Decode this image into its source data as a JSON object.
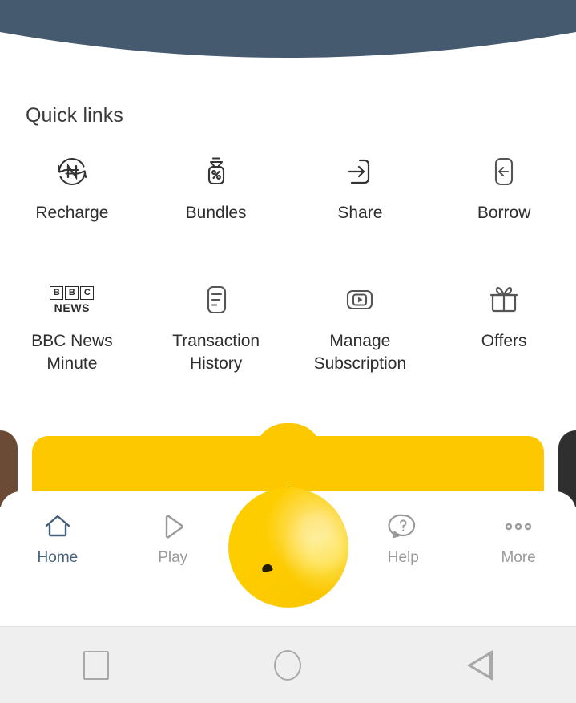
{
  "header": {
    "background_color": "#45596f",
    "shape": "curved-bottom-banner"
  },
  "quick_links": {
    "title": "Quick links",
    "items": [
      {
        "label": "Recharge",
        "icon": "recharge-naira-refresh-icon"
      },
      {
        "label": "Bundles",
        "icon": "bundle-bag-percent-icon"
      },
      {
        "label": "Share",
        "icon": "share-arrow-into-box-icon"
      },
      {
        "label": "Borrow",
        "icon": "borrow-arrow-left-box-icon"
      },
      {
        "label": "BBC News\nMinute",
        "icon": "bbc-news-logo-icon",
        "logo": {
          "letters": [
            "B",
            "B",
            "C"
          ],
          "wordmark": "NEWS"
        }
      },
      {
        "label": "Transaction\nHistory",
        "icon": "transaction-history-document-icon"
      },
      {
        "label": "Manage\nSubscription",
        "icon": "manage-subscription-play-icon"
      },
      {
        "label": "Offers",
        "icon": "offers-gift-box-icon"
      }
    ]
  },
  "promo": {
    "plus_label": "+",
    "card_color": "#fdc800",
    "left_peek_color": "#6b4a36",
    "right_peek_color": "#2f2f2f"
  },
  "tabbar": {
    "accent_color": "#46607a",
    "inactive_color": "#9a9a9a",
    "tabs": [
      {
        "label": "Home",
        "icon": "home-icon",
        "active": true
      },
      {
        "label": "Play",
        "icon": "play-triangle-icon",
        "active": false
      },
      {
        "label": "",
        "icon": "fab-placeholder",
        "active": false
      },
      {
        "label": "Help",
        "icon": "help-question-bubble-icon",
        "active": false
      },
      {
        "label": "More",
        "icon": "more-three-dots-icon",
        "active": false
      }
    ],
    "fab": {
      "icon": "yellow-circle-fab",
      "color": "#fdc800"
    }
  },
  "system_nav": {
    "background_color": "#efefef",
    "buttons": [
      {
        "name": "recents",
        "icon": "square-icon"
      },
      {
        "name": "home",
        "icon": "circle-icon"
      },
      {
        "name": "back",
        "icon": "triangle-left-icon"
      }
    ]
  }
}
